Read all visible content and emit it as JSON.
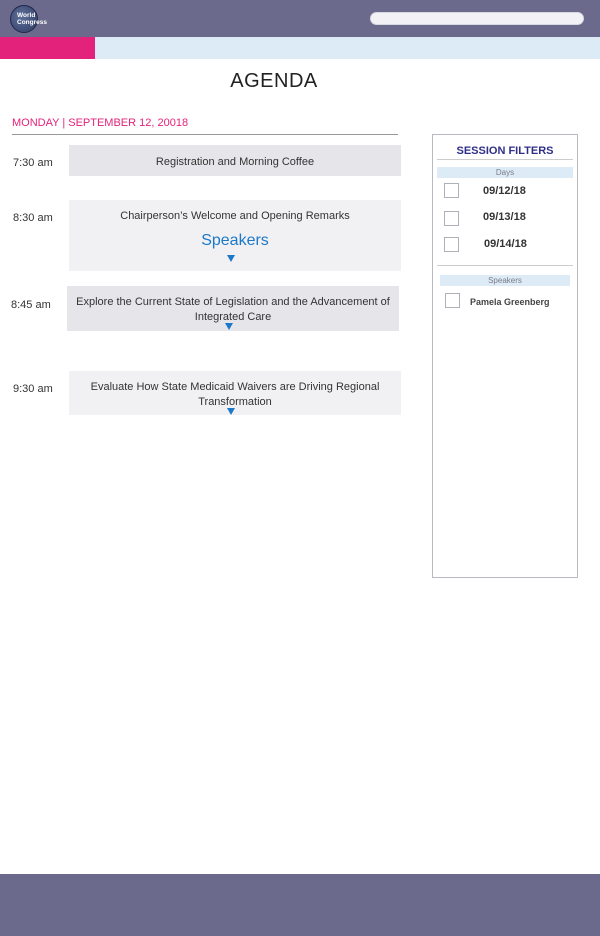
{
  "header": {
    "logo_line1": "World",
    "logo_line2": "Congress",
    "search_placeholder": ""
  },
  "page": {
    "title": "AGENDA",
    "date": "MONDAY | SEPTEMBER 12, 20018"
  },
  "sessions": [
    {
      "time": "7:30 am",
      "title": "Registration and Morning Coffee"
    },
    {
      "time": "8:30 am",
      "title": "Chairperson’s Welcome and Opening Remarks",
      "speakers_label": "Speakers"
    },
    {
      "time": "8:45 am",
      "title": "Explore the Current State of Legislation and the Advancement of Integrated Care"
    },
    {
      "time": "9:30 am",
      "title": "Evaluate How State Medicaid Waivers are Driving Regional Transformation"
    }
  ],
  "filters": {
    "title": "SESSION FILTERS",
    "days_header": "Days",
    "days": [
      "09/12/18",
      "09/13/18",
      "09/14/18"
    ],
    "speakers_header": "Speakers",
    "speakers": [
      "Pamela Greenberg"
    ]
  },
  "colors": {
    "header_bg": "#6b6a8c",
    "accent_pink": "#e3237b",
    "accent_blue": "#1d78c8",
    "nav_light_blue": "#dcebf5"
  }
}
